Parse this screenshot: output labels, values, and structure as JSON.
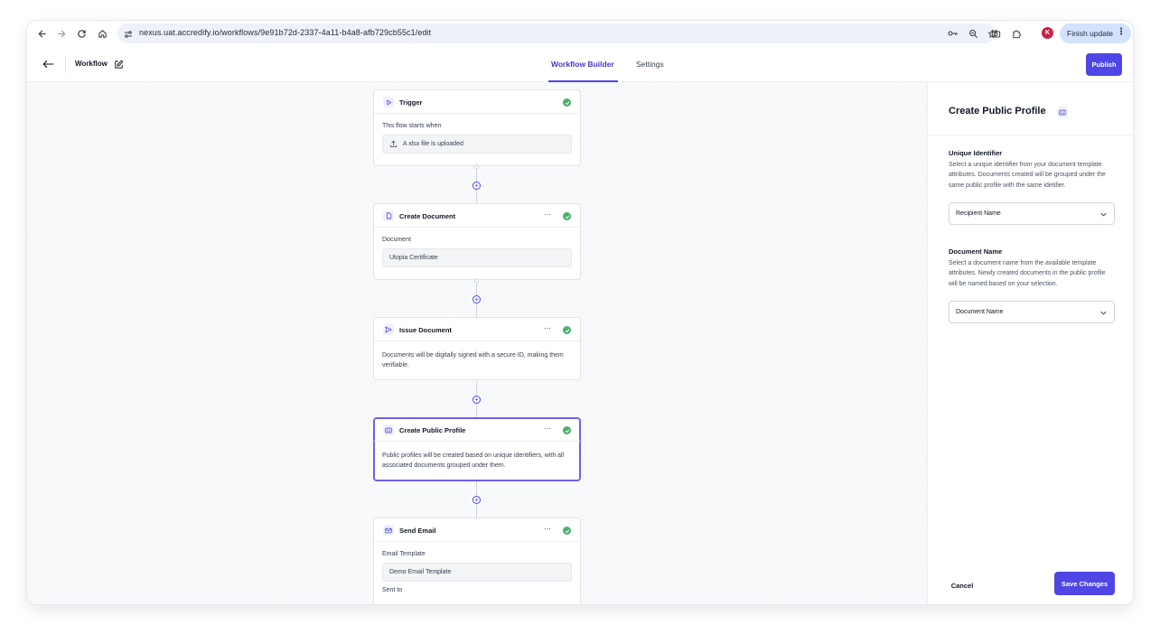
{
  "browser": {
    "url": "nexus.uat.accredify.io/workflows/9e91b72d-2337-4a11-b4a8-afb729cb55c1/edit",
    "avatar_letter": "K",
    "finish_update_label": "Finish update"
  },
  "header": {
    "title": "Workflow",
    "tabs": [
      {
        "label": "Workflow Builder",
        "active": true
      },
      {
        "label": "Settings",
        "active": false
      }
    ],
    "publish_label": "Publish"
  },
  "nodes": [
    {
      "title": "Trigger",
      "icon": "play-icon",
      "status": "complete",
      "body_label": "This flow starts when",
      "field_value": "A xlsx file is uploaded",
      "field_icon": "upload-icon"
    },
    {
      "title": "Create Document",
      "icon": "file-icon",
      "status": "complete",
      "body_label": "Document",
      "field_value": "Utopia Certificate"
    },
    {
      "title": "Issue Document",
      "icon": "send-icon",
      "status": "complete",
      "body_text": "Documents will be digitally signed with a secure ID, making them verifiable."
    },
    {
      "title": "Create Public Profile",
      "icon": "id-card-icon",
      "status": "complete",
      "selected": true,
      "body_text": "Public profiles will be created based on unique identifiers, with all associated documents grouped under them."
    },
    {
      "title": "Send Email",
      "icon": "mail-icon",
      "status": "complete",
      "body_label": "Email Template",
      "field_value": "Demo Email Template",
      "extra_label": "Sent to"
    }
  ],
  "panel": {
    "title": "Create Public Profile",
    "unique_identifier": {
      "label": "Unique Identifier",
      "description": "Select a unique identifier from your document template attributes. Documents created will be grouped under the same public profile with the same idetifier.",
      "value": "Recipient Name"
    },
    "document_name": {
      "label": "Document Name",
      "description": "Select a document name from the available template attributes. Newly created documents in the public profile will be named based on your selection.",
      "value": "Document Name"
    },
    "cancel_label": "Cancel",
    "save_label": "Save Changes"
  },
  "colors": {
    "accent": "#4f46e5",
    "success": "#4caf6e",
    "canvas_bg": "#f8f9fb"
  }
}
